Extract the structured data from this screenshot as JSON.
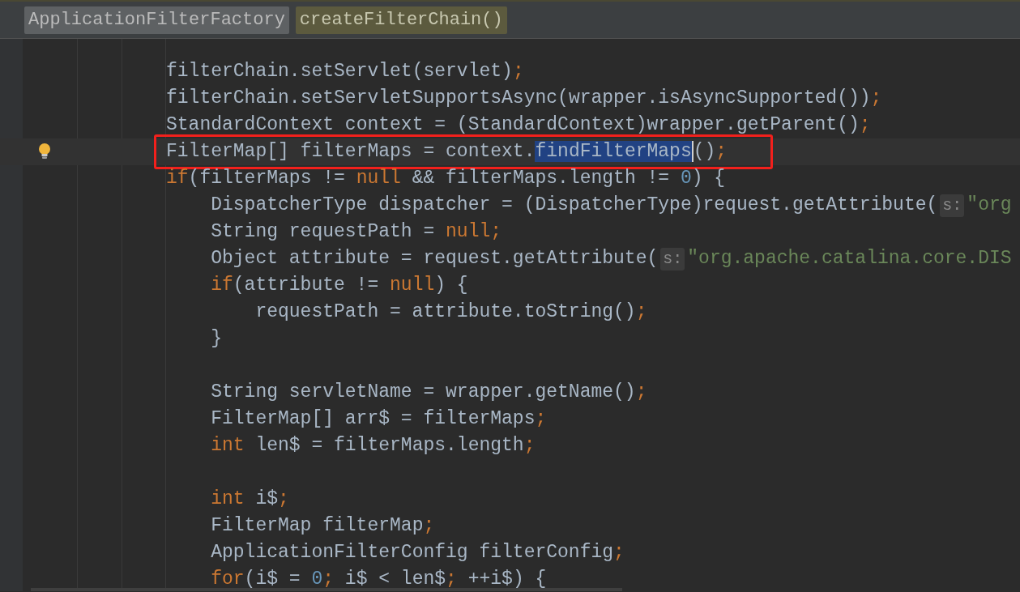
{
  "breadcrumbs": [
    {
      "text": "ApplicationFilterFactory",
      "kind": "class"
    },
    {
      "text": "createFilterChain()",
      "kind": "method"
    }
  ],
  "code": [
    {
      "tokens": [
        {
          "text": "filterChain.setServlet(servlet)",
          "kind": "plain"
        },
        {
          "text": ";",
          "kind": "keyword"
        }
      ]
    },
    {
      "tokens": [
        {
          "text": "filterChain.setServletSupportsAsync(wrapper.isAsyncSupported())",
          "kind": "plain"
        },
        {
          "text": ";",
          "kind": "keyword"
        }
      ]
    },
    {
      "tokens": [
        {
          "text": "StandardContext context = (StandardContext)wrapper.getParent()",
          "kind": "plain"
        },
        {
          "text": ";",
          "kind": "keyword"
        }
      ]
    },
    {
      "current": true,
      "bulb": true,
      "framed": true,
      "tokens": [
        {
          "text": "FilterMap[] filterMaps = context.",
          "kind": "plain"
        },
        {
          "text": "findFilterMaps",
          "kind": "selection"
        },
        {
          "text": "()",
          "kind": "plain"
        },
        {
          "text": ";",
          "kind": "keyword"
        }
      ]
    },
    {
      "tokens": [
        {
          "text": "if",
          "kind": "keyword"
        },
        {
          "text": "(filterMaps != ",
          "kind": "plain"
        },
        {
          "text": "null",
          "kind": "keyword"
        },
        {
          "text": " && filterMaps.length != ",
          "kind": "plain"
        },
        {
          "text": "0",
          "kind": "number"
        },
        {
          "text": ") {",
          "kind": "plain"
        }
      ],
      "children": [
        {
          "tokens": [
            {
              "text": "DispatcherType dispatcher = (DispatcherType)request.getAttribute(",
              "kind": "plain"
            },
            {
              "text": "s:",
              "kind": "hint"
            },
            {
              "text": "\"org",
              "kind": "string"
            }
          ]
        },
        {
          "tokens": [
            {
              "text": "String requestPath = ",
              "kind": "plain"
            },
            {
              "text": "null",
              "kind": "keyword"
            },
            {
              "text": ";",
              "kind": "keyword"
            }
          ]
        },
        {
          "tokens": [
            {
              "text": "Object attribute = request.getAttribute(",
              "kind": "plain"
            },
            {
              "text": "s:",
              "kind": "hint"
            },
            {
              "text": "\"org.apache.catalina.core.DIS",
              "kind": "string"
            }
          ]
        },
        {
          "tokens": [
            {
              "text": "if",
              "kind": "keyword"
            },
            {
              "text": "(attribute != ",
              "kind": "plain"
            },
            {
              "text": "null",
              "kind": "keyword"
            },
            {
              "text": ") {",
              "kind": "plain"
            }
          ],
          "children": [
            {
              "tokens": [
                {
                  "text": "requestPath = attribute.toString()",
                  "kind": "plain"
                },
                {
                  "text": ";",
                  "kind": "keyword"
                }
              ]
            }
          ]
        },
        {
          "tokens": [
            {
              "text": "}",
              "kind": "plain"
            }
          ]
        },
        {
          "kind": "blank"
        },
        {
          "tokens": [
            {
              "text": "String servletName = wrapper.getName()",
              "kind": "plain"
            },
            {
              "text": ";",
              "kind": "keyword"
            }
          ]
        },
        {
          "tokens": [
            {
              "text": "FilterMap[] arr$ = filterMaps",
              "kind": "plain"
            },
            {
              "text": ";",
              "kind": "keyword"
            }
          ]
        },
        {
          "tokens": [
            {
              "text": "int",
              "kind": "keyword"
            },
            {
              "text": " len$ = filterMaps.length",
              "kind": "plain"
            },
            {
              "text": ";",
              "kind": "keyword"
            }
          ]
        },
        {
          "kind": "blank"
        },
        {
          "tokens": [
            {
              "text": "int",
              "kind": "keyword"
            },
            {
              "text": " i$",
              "kind": "plain"
            },
            {
              "text": ";",
              "kind": "keyword"
            }
          ]
        },
        {
          "tokens": [
            {
              "text": "FilterMap filterMap",
              "kind": "plain"
            },
            {
              "text": ";",
              "kind": "keyword"
            }
          ]
        },
        {
          "tokens": [
            {
              "text": "ApplicationFilterConfig filterConfig",
              "kind": "plain"
            },
            {
              "text": ";",
              "kind": "keyword"
            }
          ]
        },
        {
          "tokens": [
            {
              "text": "for",
              "kind": "keyword"
            },
            {
              "text": "(i$ = ",
              "kind": "plain"
            },
            {
              "text": "0",
              "kind": "number"
            },
            {
              "text": "; ",
              "kind": "keyword"
            },
            {
              "text": "i$ < len$",
              "kind": "plain"
            },
            {
              "text": "; ",
              "kind": "keyword"
            },
            {
              "text": "++i$) {",
              "kind": "plain"
            }
          ]
        }
      ]
    }
  ]
}
